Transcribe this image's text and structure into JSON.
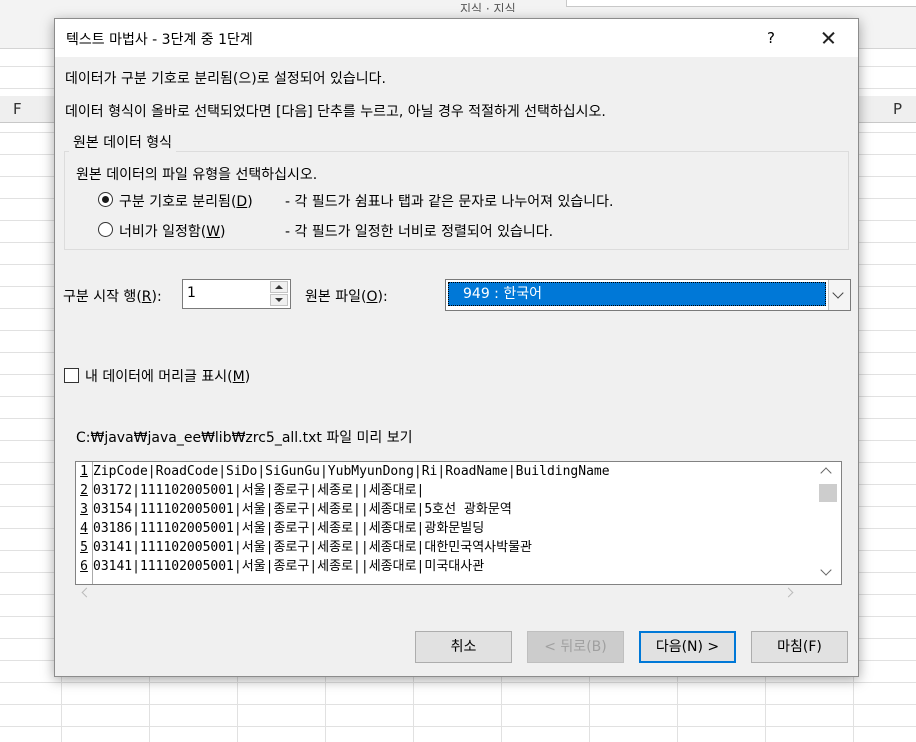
{
  "sheet": {
    "tabs": "지식 · 지식",
    "col_left": "F",
    "col_right": "P"
  },
  "dialog": {
    "title": "텍스트 마법사 - 3단계 중 1단계",
    "help": "?",
    "line1": "데이터가 구분 기호로 분리됨(으)로 설정되어 있습니다.",
    "line2": "데이터 형식이 올바로 선택되었다면 [다음] 단추를 누르고, 아닐 경우 적절하게 선택하십시오."
  },
  "group": {
    "title": "원본 데이터 형식",
    "prompt": "원본 데이터의 파일 유형을 선택하십시오.",
    "options": [
      {
        "label": "구분 기호로 분리됨",
        "mnemonic": "D",
        "desc": "- 각 필드가 쉼표나 탭과 같은 문자로 나누어져 있습니다.",
        "checked": true
      },
      {
        "label": "너비가 일정함",
        "mnemonic": "W",
        "desc": "- 각 필드가 일정한 너비로 정렬되어 있습니다.",
        "checked": false
      }
    ]
  },
  "start_row": {
    "label": "구분 시작 행",
    "mnemonic": "R",
    "value": "1"
  },
  "origin": {
    "label": "원본 파일",
    "mnemonic": "O",
    "value": "949 : 한국어"
  },
  "header": {
    "label": "내 데이터에 머리글 표시",
    "mnemonic": "M",
    "checked": false
  },
  "preview": {
    "caption": "C:₩java₩java_ee₩lib₩zrc5_all.txt 파일 미리 보기",
    "rows": [
      {
        "n": "1",
        "text": "ZipCode|RoadCode|SiDo|SiGunGu|YubMyunDong|Ri|RoadName|BuildingName"
      },
      {
        "n": "2",
        "text": "03172|111102005001|서울|종로구|세종로||세종대로|"
      },
      {
        "n": "3",
        "text": "03154|111102005001|서울|종로구|세종로||세종대로|5호선 광화문역"
      },
      {
        "n": "4",
        "text": "03186|111102005001|서울|종로구|세종로||세종대로|광화문빌딩"
      },
      {
        "n": "5",
        "text": "03141|111102005001|서울|종로구|세종로||세종대로|대한민국역사박물관"
      },
      {
        "n": "6",
        "text": "03141|111102005001|서울|종로구|세종로||세종대로|미국대사관"
      }
    ]
  },
  "buttons": {
    "cancel": "취소",
    "back": "< 뒤로(B)",
    "next": "다음(N) >",
    "finish": "마침(F)"
  }
}
